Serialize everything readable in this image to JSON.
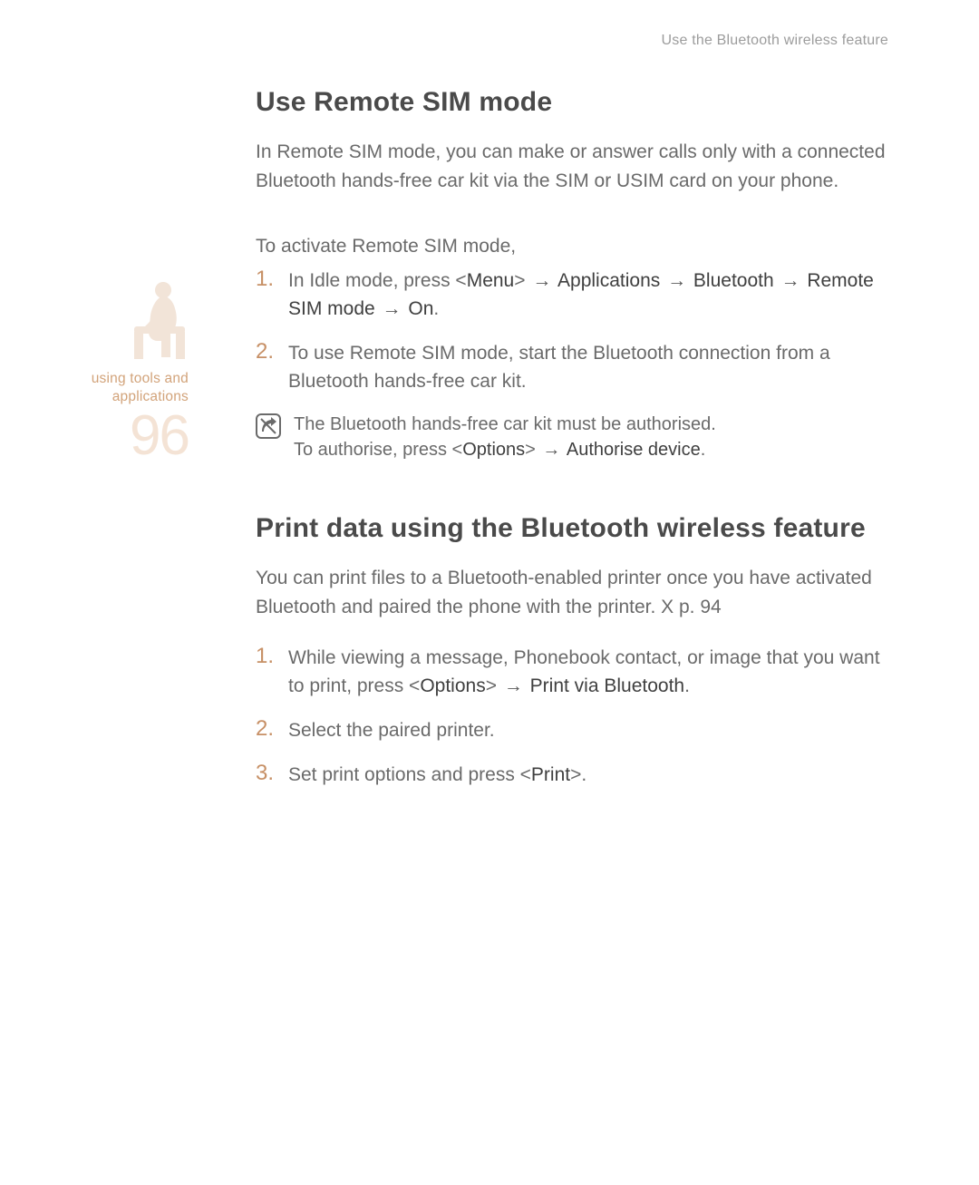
{
  "running_head": "Use the Bluetooth wireless feature",
  "sidebar": {
    "label_line1": "using tools and",
    "label_line2": "applications",
    "page_number": "96"
  },
  "section1": {
    "heading": "Use Remote SIM mode",
    "intro": "In Remote SIM mode, you can make or answer calls only with a connected Bluetooth hands-free car kit via the SIM or USIM card on your phone.",
    "lead_in": "To activate Remote SIM mode,",
    "step1": {
      "num": "1.",
      "pre": "In Idle mode, press <",
      "menu": "Menu",
      "post_menu": "> ",
      "arrow1": "→",
      "app": " Applications ",
      "arrow2": "→",
      "bt": " Bluetooth ",
      "arrow3": "→",
      "rsm": " Remote SIM mode ",
      "arrow4": "→",
      "on": " On",
      "period": "."
    },
    "step2": {
      "num": "2.",
      "text": "To use Remote SIM mode, start the Bluetooth connection from a Bluetooth hands-free car kit."
    },
    "note": {
      "line1": "The Bluetooth hands-free car kit must be authorised.",
      "line2_pre": "To authorise, press <",
      "options": "Options",
      "line2_mid": "> ",
      "arrow": "→",
      "auth": " Authorise device",
      "period": "."
    }
  },
  "section2": {
    "heading": "Print data using the Bluetooth wireless feature",
    "intro_pre": "You can print files to a Bluetooth-enabled printer once you have activated Bluetooth and paired the phone with the printer.  ",
    "xref_marker": "X",
    "xref_text": " p. 94",
    "step1": {
      "num": "1.",
      "pre": "While viewing a message, Phonebook contact, or image that you want to print, press <",
      "options": "Options",
      "mid": "> ",
      "arrow": "→",
      "pvb": " Print via Bluetooth",
      "period": "."
    },
    "step2": {
      "num": "2.",
      "text": "Select the paired printer."
    },
    "step3": {
      "num": "3.",
      "pre": "Set print options and press <",
      "print": "Print",
      "post": ">."
    }
  }
}
